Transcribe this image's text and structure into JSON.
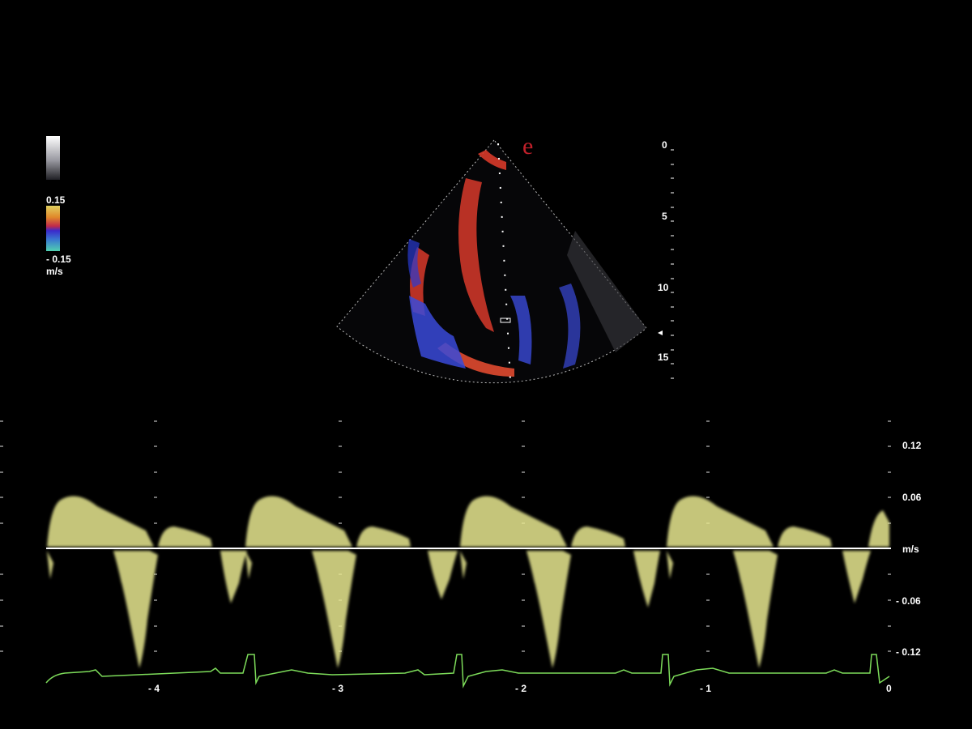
{
  "colormap": {
    "top_value": "0.15",
    "bottom_value": "- 0.15",
    "unit": "m/s"
  },
  "view": {
    "marker": "e",
    "depth_labels": [
      "0",
      "5",
      "10",
      "15"
    ]
  },
  "doppler": {
    "velocity_labels": [
      "0.12",
      "0.06",
      "m/s",
      "- 0.06",
      "- 0.12"
    ],
    "time_labels": [
      "- 4",
      "- 3",
      "- 2",
      "- 1",
      "0"
    ],
    "trace_color": "#e8e890",
    "ecg_color": "#7ddc5a",
    "baseline_color": "#ffffff"
  }
}
